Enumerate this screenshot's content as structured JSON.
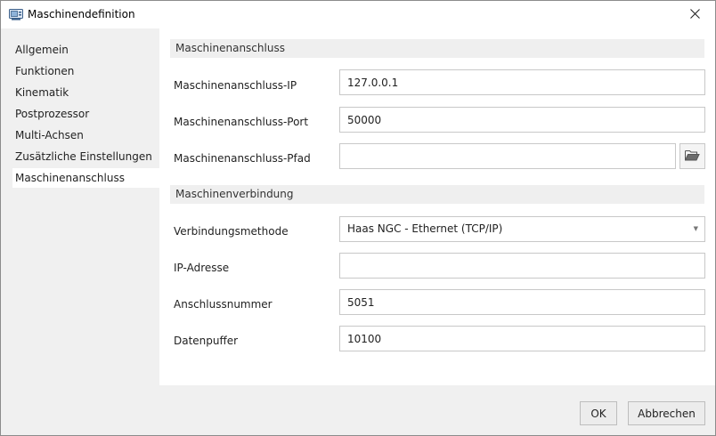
{
  "window": {
    "title": "Maschinendefinition",
    "close_label": "×"
  },
  "nav": {
    "items": [
      {
        "label": "Allgemein",
        "active": false
      },
      {
        "label": "Funktionen",
        "active": false
      },
      {
        "label": "Kinematik",
        "active": false
      },
      {
        "label": "Postprozessor",
        "active": false
      },
      {
        "label": "Multi-Achsen",
        "active": false
      },
      {
        "label": "Zusätzliche Einstellungen",
        "active": false
      },
      {
        "label": "Maschinenanschluss",
        "active": true
      }
    ]
  },
  "section_connection": {
    "header": "Maschinenanschluss",
    "ip_label": "Maschinenanschluss-IP",
    "ip_value": "127.0.0.1",
    "port_label": "Maschinenanschluss-Port",
    "port_value": "50000",
    "path_label": "Maschinenanschluss-Pfad",
    "path_value": ""
  },
  "section_link": {
    "header": "Maschinenverbindung",
    "method_label": "Verbindungsmethode",
    "method_value": "Haas NGC - Ethernet (TCP/IP)",
    "ip_label": "IP-Adresse",
    "ip_value": "",
    "port_label": "Anschlussnummer",
    "port_value": "5051",
    "buffer_label": "Datenpuffer",
    "buffer_value": "10100"
  },
  "footer": {
    "ok_label": "OK",
    "cancel_label": "Abbrechen"
  },
  "icons": {
    "app": "machine-definition-icon",
    "close": "close-icon",
    "browse": "folder-open-icon",
    "dropdown": "chevron-down-icon"
  },
  "colors": {
    "content_bg": "#ffffff",
    "nav_bg": "#f0f0f0",
    "section_header_bg": "#efefef",
    "active_item_bg": "#ffffff"
  }
}
